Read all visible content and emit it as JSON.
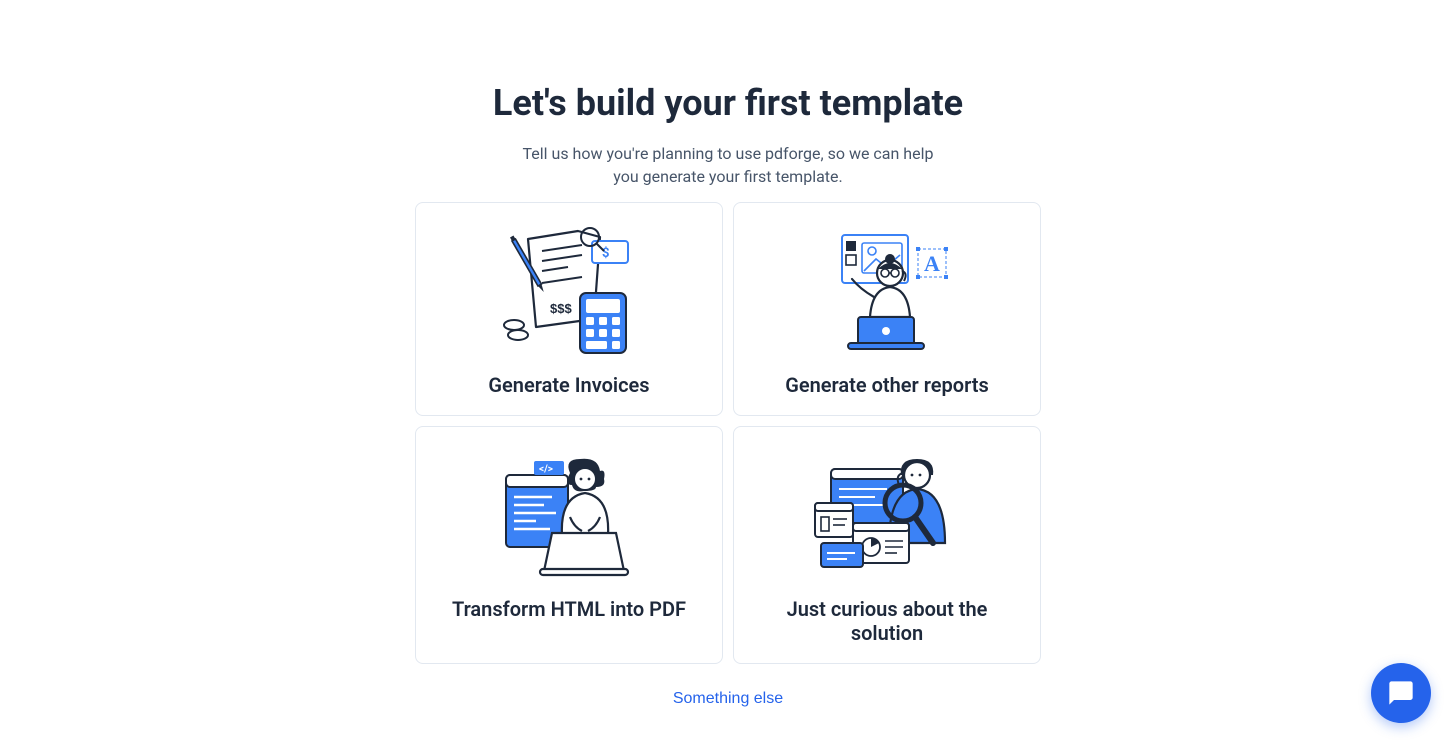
{
  "header": {
    "title": "Let's build your first template",
    "subtitle": "Tell us how you're planning to use pdforge, so we can help you generate your first template."
  },
  "options": [
    {
      "id": "invoices",
      "label": "Generate Invoices",
      "icon": "invoice-illustration"
    },
    {
      "id": "other-reports",
      "label": "Generate other reports",
      "icon": "reports-illustration"
    },
    {
      "id": "html-to-pdf",
      "label": "Transform HTML into PDF",
      "icon": "html-illustration"
    },
    {
      "id": "curious",
      "label": "Just curious about the solution",
      "icon": "curious-illustration"
    }
  ],
  "footer": {
    "something_else": "Something else"
  },
  "colors": {
    "accent": "#2563eb",
    "outline": "#1e293b"
  }
}
